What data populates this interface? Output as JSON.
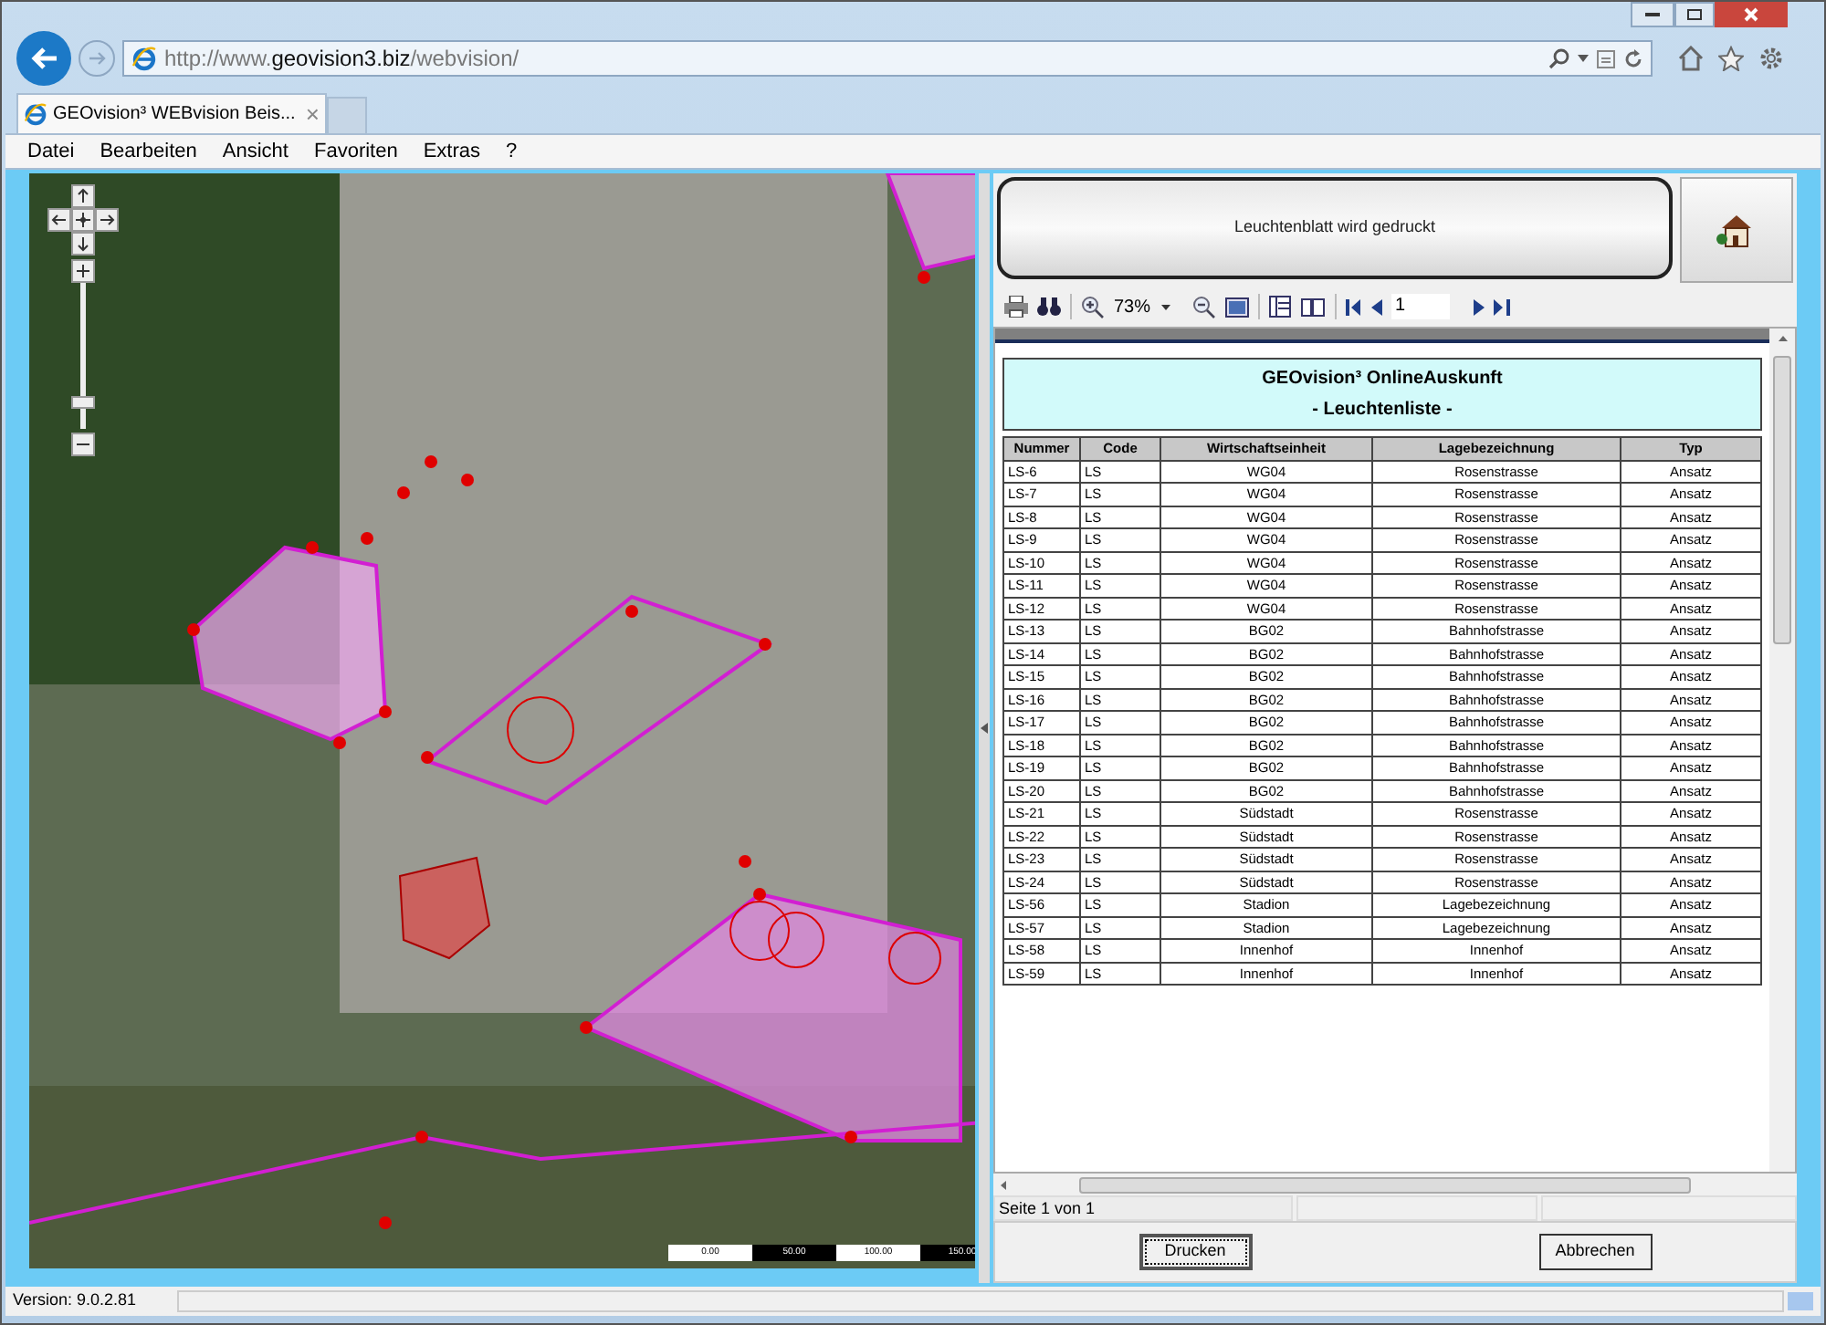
{
  "browser": {
    "address": {
      "host_prefix": "http://www.",
      "host": "geovision3.biz",
      "path": "/webvision/"
    },
    "tabs": [
      {
        "label": "GEOvision³ WEBvision Beis...",
        "selected": true,
        "close": "×"
      },
      {
        "selected": false
      }
    ],
    "menu": [
      "Datei",
      "Bearbeiten",
      "Ansicht",
      "Favoriten",
      "Extras",
      "?"
    ]
  },
  "map": {
    "zoom_slider": {
      "level": 0.15
    },
    "scale_labels": [
      "0.00",
      "50.00",
      "100.00",
      "150.00"
    ]
  },
  "print_panel": {
    "banner": "Leuchtenblatt wird gedruckt",
    "zoom": "73%",
    "page_input": "1",
    "report": {
      "title": "GEOvision³ OnlineAuskunft",
      "subtitle": "- Leuchtenliste -",
      "columns": [
        "Nummer",
        "Code",
        "Wirtschaftseinheit",
        "Lagebezeichnung",
        "Typ"
      ],
      "rows": [
        [
          "LS-6",
          "LS",
          "WG04",
          "Rosenstrasse",
          "Ansatz"
        ],
        [
          "LS-7",
          "LS",
          "WG04",
          "Rosenstrasse",
          "Ansatz"
        ],
        [
          "LS-8",
          "LS",
          "WG04",
          "Rosenstrasse",
          "Ansatz"
        ],
        [
          "LS-9",
          "LS",
          "WG04",
          "Rosenstrasse",
          "Ansatz"
        ],
        [
          "LS-10",
          "LS",
          "WG04",
          "Rosenstrasse",
          "Ansatz"
        ],
        [
          "LS-11",
          "LS",
          "WG04",
          "Rosenstrasse",
          "Ansatz"
        ],
        [
          "LS-12",
          "LS",
          "WG04",
          "Rosenstrasse",
          "Ansatz"
        ],
        [
          "LS-13",
          "LS",
          "BG02",
          "Bahnhofstrasse",
          "Ansatz"
        ],
        [
          "LS-14",
          "LS",
          "BG02",
          "Bahnhofstrasse",
          "Ansatz"
        ],
        [
          "LS-15",
          "LS",
          "BG02",
          "Bahnhofstrasse",
          "Ansatz"
        ],
        [
          "LS-16",
          "LS",
          "BG02",
          "Bahnhofstrasse",
          "Ansatz"
        ],
        [
          "LS-17",
          "LS",
          "BG02",
          "Bahnhofstrasse",
          "Ansatz"
        ],
        [
          "LS-18",
          "LS",
          "BG02",
          "Bahnhofstrasse",
          "Ansatz"
        ],
        [
          "LS-19",
          "LS",
          "BG02",
          "Bahnhofstrasse",
          "Ansatz"
        ],
        [
          "LS-20",
          "LS",
          "BG02",
          "Bahnhofstrasse",
          "Ansatz"
        ],
        [
          "LS-21",
          "LS",
          "Südstadt",
          "Rosenstrasse",
          "Ansatz"
        ],
        [
          "LS-22",
          "LS",
          "Südstadt",
          "Rosenstrasse",
          "Ansatz"
        ],
        [
          "LS-23",
          "LS",
          "Südstadt",
          "Rosenstrasse",
          "Ansatz"
        ],
        [
          "LS-24",
          "LS",
          "Südstadt",
          "Rosenstrasse",
          "Ansatz"
        ],
        [
          "LS-56",
          "LS",
          "Stadion",
          "Lagebezeichnung",
          "Ansatz"
        ],
        [
          "LS-57",
          "LS",
          "Stadion",
          "Lagebezeichnung",
          "Ansatz"
        ],
        [
          "LS-58",
          "LS",
          "Innenhof",
          "Innenhof",
          "Ansatz"
        ],
        [
          "LS-59",
          "LS",
          "Innenhof",
          "Innenhof",
          "Ansatz"
        ]
      ]
    },
    "status": "Seite 1 von 1",
    "buttons": [
      "Drucken",
      "Abbrechen"
    ]
  },
  "version": "Version: 9.0.2.81"
}
